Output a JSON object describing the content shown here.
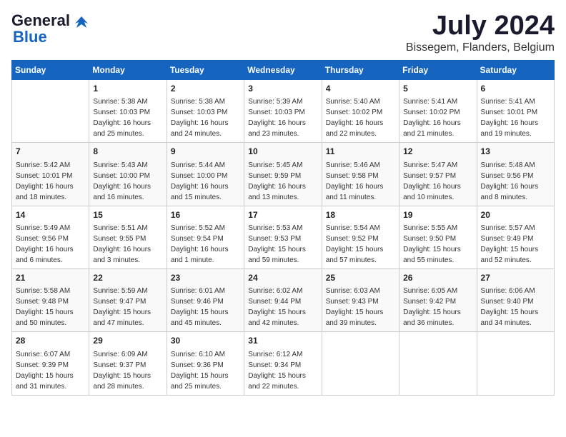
{
  "header": {
    "logo_line1": "General",
    "logo_line2": "Blue",
    "month_year": "July 2024",
    "location": "Bissegem, Flanders, Belgium"
  },
  "days_of_week": [
    "Sunday",
    "Monday",
    "Tuesday",
    "Wednesday",
    "Thursday",
    "Friday",
    "Saturday"
  ],
  "weeks": [
    [
      {
        "day": null,
        "info": null
      },
      {
        "day": "1",
        "info": "Sunrise: 5:38 AM\nSunset: 10:03 PM\nDaylight: 16 hours\nand 25 minutes."
      },
      {
        "day": "2",
        "info": "Sunrise: 5:38 AM\nSunset: 10:03 PM\nDaylight: 16 hours\nand 24 minutes."
      },
      {
        "day": "3",
        "info": "Sunrise: 5:39 AM\nSunset: 10:03 PM\nDaylight: 16 hours\nand 23 minutes."
      },
      {
        "day": "4",
        "info": "Sunrise: 5:40 AM\nSunset: 10:02 PM\nDaylight: 16 hours\nand 22 minutes."
      },
      {
        "day": "5",
        "info": "Sunrise: 5:41 AM\nSunset: 10:02 PM\nDaylight: 16 hours\nand 21 minutes."
      },
      {
        "day": "6",
        "info": "Sunrise: 5:41 AM\nSunset: 10:01 PM\nDaylight: 16 hours\nand 19 minutes."
      }
    ],
    [
      {
        "day": "7",
        "info": "Sunrise: 5:42 AM\nSunset: 10:01 PM\nDaylight: 16 hours\nand 18 minutes."
      },
      {
        "day": "8",
        "info": "Sunrise: 5:43 AM\nSunset: 10:00 PM\nDaylight: 16 hours\nand 16 minutes."
      },
      {
        "day": "9",
        "info": "Sunrise: 5:44 AM\nSunset: 10:00 PM\nDaylight: 16 hours\nand 15 minutes."
      },
      {
        "day": "10",
        "info": "Sunrise: 5:45 AM\nSunset: 9:59 PM\nDaylight: 16 hours\nand 13 minutes."
      },
      {
        "day": "11",
        "info": "Sunrise: 5:46 AM\nSunset: 9:58 PM\nDaylight: 16 hours\nand 11 minutes."
      },
      {
        "day": "12",
        "info": "Sunrise: 5:47 AM\nSunset: 9:57 PM\nDaylight: 16 hours\nand 10 minutes."
      },
      {
        "day": "13",
        "info": "Sunrise: 5:48 AM\nSunset: 9:56 PM\nDaylight: 16 hours\nand 8 minutes."
      }
    ],
    [
      {
        "day": "14",
        "info": "Sunrise: 5:49 AM\nSunset: 9:56 PM\nDaylight: 16 hours\nand 6 minutes."
      },
      {
        "day": "15",
        "info": "Sunrise: 5:51 AM\nSunset: 9:55 PM\nDaylight: 16 hours\nand 3 minutes."
      },
      {
        "day": "16",
        "info": "Sunrise: 5:52 AM\nSunset: 9:54 PM\nDaylight: 16 hours\nand 1 minute."
      },
      {
        "day": "17",
        "info": "Sunrise: 5:53 AM\nSunset: 9:53 PM\nDaylight: 15 hours\nand 59 minutes."
      },
      {
        "day": "18",
        "info": "Sunrise: 5:54 AM\nSunset: 9:52 PM\nDaylight: 15 hours\nand 57 minutes."
      },
      {
        "day": "19",
        "info": "Sunrise: 5:55 AM\nSunset: 9:50 PM\nDaylight: 15 hours\nand 55 minutes."
      },
      {
        "day": "20",
        "info": "Sunrise: 5:57 AM\nSunset: 9:49 PM\nDaylight: 15 hours\nand 52 minutes."
      }
    ],
    [
      {
        "day": "21",
        "info": "Sunrise: 5:58 AM\nSunset: 9:48 PM\nDaylight: 15 hours\nand 50 minutes."
      },
      {
        "day": "22",
        "info": "Sunrise: 5:59 AM\nSunset: 9:47 PM\nDaylight: 15 hours\nand 47 minutes."
      },
      {
        "day": "23",
        "info": "Sunrise: 6:01 AM\nSunset: 9:46 PM\nDaylight: 15 hours\nand 45 minutes."
      },
      {
        "day": "24",
        "info": "Sunrise: 6:02 AM\nSunset: 9:44 PM\nDaylight: 15 hours\nand 42 minutes."
      },
      {
        "day": "25",
        "info": "Sunrise: 6:03 AM\nSunset: 9:43 PM\nDaylight: 15 hours\nand 39 minutes."
      },
      {
        "day": "26",
        "info": "Sunrise: 6:05 AM\nSunset: 9:42 PM\nDaylight: 15 hours\nand 36 minutes."
      },
      {
        "day": "27",
        "info": "Sunrise: 6:06 AM\nSunset: 9:40 PM\nDaylight: 15 hours\nand 34 minutes."
      }
    ],
    [
      {
        "day": "28",
        "info": "Sunrise: 6:07 AM\nSunset: 9:39 PM\nDaylight: 15 hours\nand 31 minutes."
      },
      {
        "day": "29",
        "info": "Sunrise: 6:09 AM\nSunset: 9:37 PM\nDaylight: 15 hours\nand 28 minutes."
      },
      {
        "day": "30",
        "info": "Sunrise: 6:10 AM\nSunset: 9:36 PM\nDaylight: 15 hours\nand 25 minutes."
      },
      {
        "day": "31",
        "info": "Sunrise: 6:12 AM\nSunset: 9:34 PM\nDaylight: 15 hours\nand 22 minutes."
      },
      {
        "day": null,
        "info": null
      },
      {
        "day": null,
        "info": null
      },
      {
        "day": null,
        "info": null
      }
    ]
  ]
}
